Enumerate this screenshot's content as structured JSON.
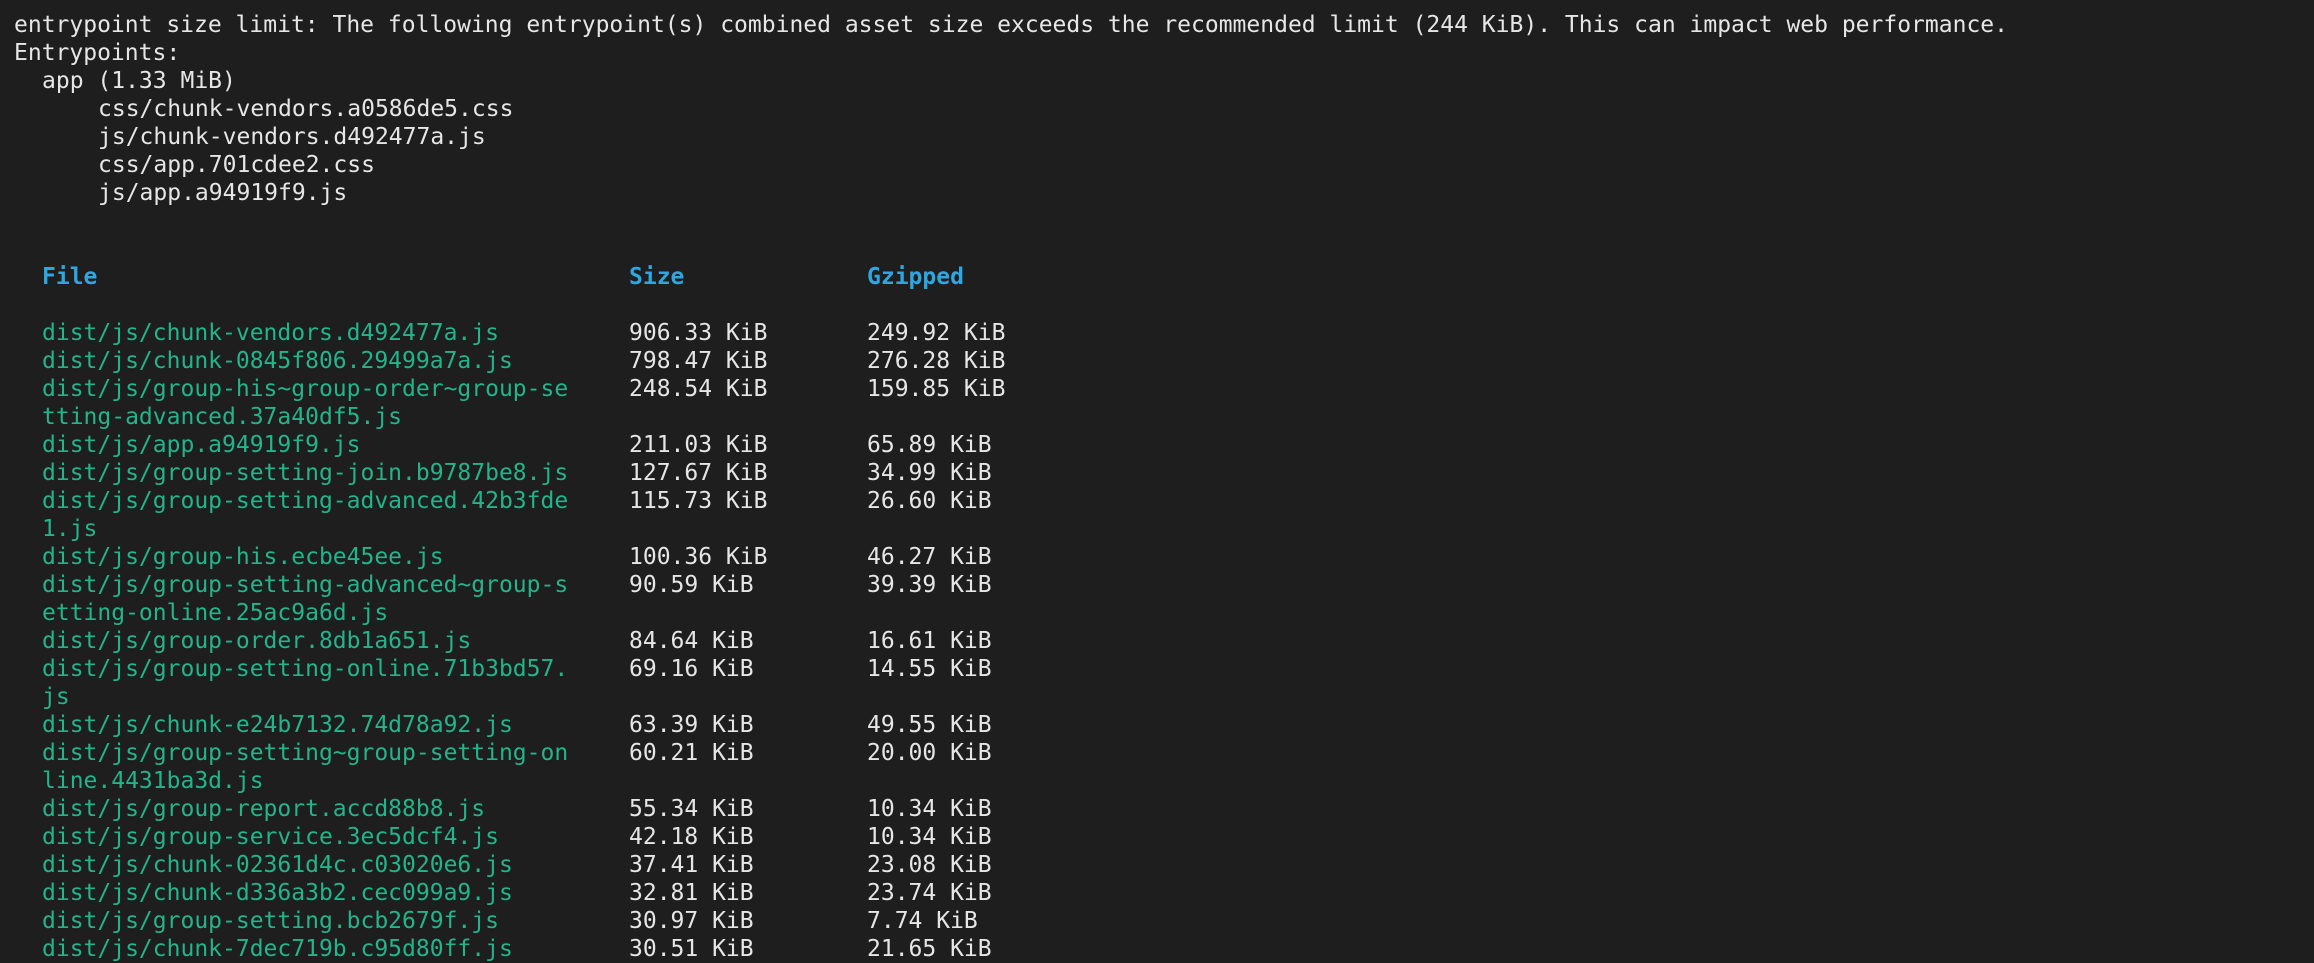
{
  "warning": "entrypoint size limit: The following entrypoint(s) combined asset size exceeds the recommended limit (244 KiB). This can impact web performance.",
  "entrypoints_label": "Entrypoints:",
  "app_entry": "app (1.33 MiB)",
  "entry_assets": [
    "css/chunk-vendors.a0586de5.css",
    "js/chunk-vendors.d492477a.js",
    "css/app.701cdee2.css",
    "js/app.a94919f9.js"
  ],
  "table": {
    "headers": {
      "file": "File",
      "size": "Size",
      "gzipped": "Gzipped"
    },
    "rows": [
      {
        "file": [
          "dist/js/chunk-vendors.d492477a.js"
        ],
        "size": "906.33 KiB",
        "gzipped": "249.92 KiB"
      },
      {
        "file": [
          "dist/js/chunk-0845f806.29499a7a.js"
        ],
        "size": "798.47 KiB",
        "gzipped": "276.28 KiB"
      },
      {
        "file": [
          "dist/js/group-his~group-order~group-se",
          "tting-advanced.37a40df5.js"
        ],
        "size": "248.54 KiB",
        "gzipped": "159.85 KiB"
      },
      {
        "file": [
          "dist/js/app.a94919f9.js"
        ],
        "size": "211.03 KiB",
        "gzipped": "65.89 KiB"
      },
      {
        "file": [
          "dist/js/group-setting-join.b9787be8.js"
        ],
        "size": "127.67 KiB",
        "gzipped": "34.99 KiB"
      },
      {
        "file": [
          "dist/js/group-setting-advanced.42b3fde",
          "1.js"
        ],
        "size": "115.73 KiB",
        "gzipped": "26.60 KiB"
      },
      {
        "file": [
          "dist/js/group-his.ecbe45ee.js"
        ],
        "size": "100.36 KiB",
        "gzipped": "46.27 KiB"
      },
      {
        "file": [
          "dist/js/group-setting-advanced~group-s",
          "etting-online.25ac9a6d.js"
        ],
        "size": "90.59 KiB",
        "gzipped": "39.39 KiB"
      },
      {
        "file": [
          "dist/js/group-order.8db1a651.js"
        ],
        "size": "84.64 KiB",
        "gzipped": "16.61 KiB"
      },
      {
        "file": [
          "dist/js/group-setting-online.71b3bd57.",
          "js"
        ],
        "size": "69.16 KiB",
        "gzipped": "14.55 KiB"
      },
      {
        "file": [
          "dist/js/chunk-e24b7132.74d78a92.js"
        ],
        "size": "63.39 KiB",
        "gzipped": "49.55 KiB"
      },
      {
        "file": [
          "dist/js/group-setting~group-setting-on",
          "line.4431ba3d.js"
        ],
        "size": "60.21 KiB",
        "gzipped": "20.00 KiB"
      },
      {
        "file": [
          "dist/js/group-report.accd88b8.js"
        ],
        "size": "55.34 KiB",
        "gzipped": "10.34 KiB"
      },
      {
        "file": [
          "dist/js/group-service.3ec5dcf4.js"
        ],
        "size": "42.18 KiB",
        "gzipped": "10.34 KiB"
      },
      {
        "file": [
          "dist/js/chunk-02361d4c.c03020e6.js"
        ],
        "size": "37.41 KiB",
        "gzipped": "23.08 KiB"
      },
      {
        "file": [
          "dist/js/chunk-d336a3b2.cec099a9.js"
        ],
        "size": "32.81 KiB",
        "gzipped": "23.74 KiB"
      },
      {
        "file": [
          "dist/js/group-setting.bcb2679f.js"
        ],
        "size": "30.97 KiB",
        "gzipped": "7.74 KiB"
      },
      {
        "file": [
          "dist/js/chunk-7dec719b.c95d80ff.js"
        ],
        "size": "30.51 KiB",
        "gzipped": "21.65 KiB"
      }
    ]
  },
  "colors": {
    "background": "#1e1e1e",
    "text": "#e6e6e6",
    "file": "#23b58a",
    "header": "#2ea7e0"
  }
}
